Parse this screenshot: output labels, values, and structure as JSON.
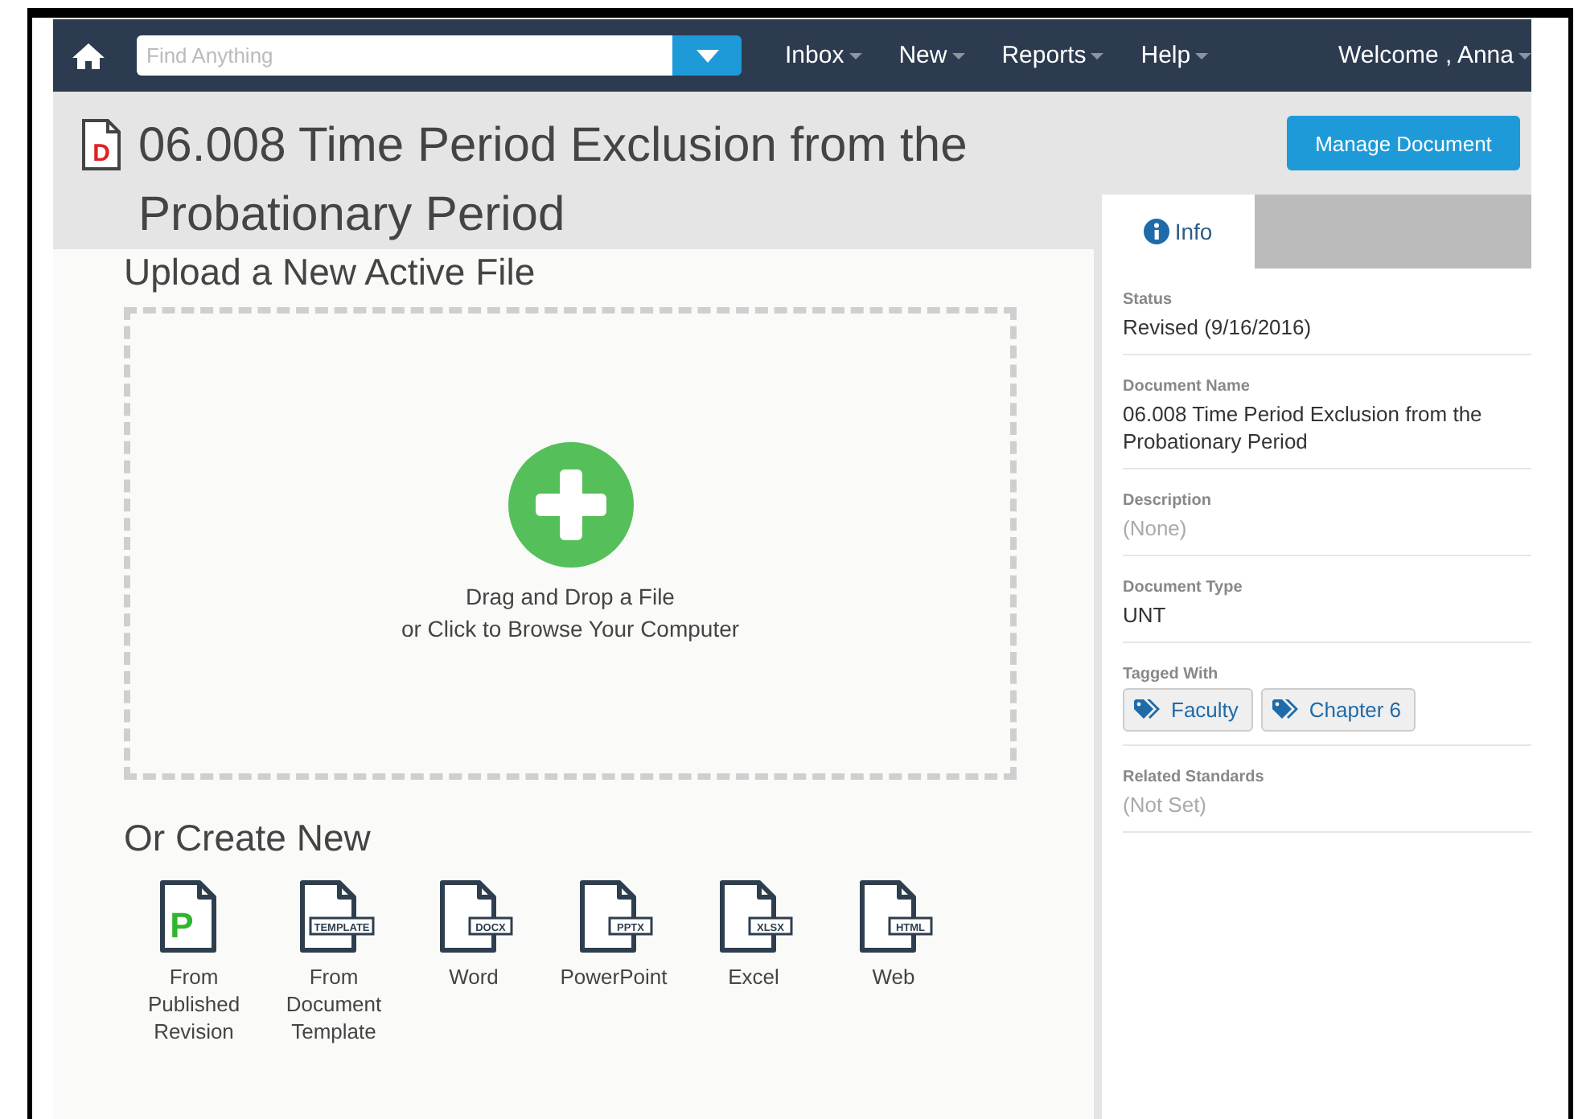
{
  "nav": {
    "search": {
      "placeholder": "Find Anything"
    },
    "menu": [
      {
        "label": "Inbox"
      },
      {
        "label": "New"
      },
      {
        "label": "Reports"
      },
      {
        "label": "Help"
      }
    ],
    "user": "Welcome , Anna"
  },
  "document": {
    "badge": "D",
    "title": "06.008 Time Period Exclusion from the Probationary Period",
    "manage_button": "Manage Document"
  },
  "upload": {
    "heading": "Upload a New Active File",
    "drop_lines": [
      "Drag and Drop a File",
      "or Click to Browse Your Computer"
    ]
  },
  "create": {
    "heading": "Or Create New",
    "options": [
      {
        "kind": "published",
        "mark": "P",
        "label": "From Published Revision"
      },
      {
        "kind": "tagged",
        "mark": "TEMPLATE",
        "label": "From Document Template"
      },
      {
        "kind": "tagged",
        "mark": "DOCX",
        "label": "Word"
      },
      {
        "kind": "tagged",
        "mark": "PPTX",
        "label": "PowerPoint"
      },
      {
        "kind": "tagged",
        "mark": "XLSX",
        "label": "Excel"
      },
      {
        "kind": "tagged",
        "mark": "HTML",
        "label": "Web"
      }
    ]
  },
  "sidebar": {
    "tabs": [
      {
        "label": "Info",
        "selected": true
      }
    ],
    "fields": [
      {
        "kind": "text",
        "label": "Status",
        "value": "Revised (9/16/2016)"
      },
      {
        "kind": "text",
        "label": "Document Name",
        "value": "06.008 Time Period Exclusion from the Probationary Period"
      },
      {
        "kind": "empty",
        "label": "Description",
        "value": "(None)"
      },
      {
        "kind": "text",
        "label": "Document Type",
        "value": "UNT"
      },
      {
        "kind": "tags",
        "label": "Tagged With",
        "tags": [
          "Faculty",
          "Chapter 6"
        ]
      },
      {
        "kind": "empty",
        "label": "Related Standards",
        "value": "(Not Set)"
      }
    ]
  }
}
